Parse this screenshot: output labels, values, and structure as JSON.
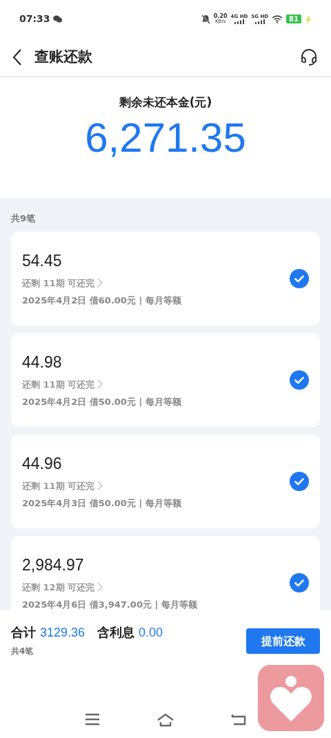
{
  "status_bar": {
    "time": "07:33",
    "speed": "0.20",
    "speed_unit": "KB/s",
    "sim1": "4G HD",
    "sim2": "5G HD",
    "battery": "81"
  },
  "header": {
    "title": "查账还款"
  },
  "summary": {
    "label": "剩余未还本金(元)",
    "amount": "6,271.35"
  },
  "list": {
    "count": "共9笔",
    "loans": [
      {
        "amount": "54.45",
        "remaining": "还剩 11期 可还完",
        "detail": "2025年4月2日 借60.00元 | 每月等额",
        "selected": true
      },
      {
        "amount": "44.98",
        "remaining": "还剩 11期 可还完",
        "detail": "2025年4月2日 借50.00元 | 每月等额",
        "selected": true
      },
      {
        "amount": "44.96",
        "remaining": "还剩 11期 可还完",
        "detail": "2025年4月3日 借50.00元 | 每月等额",
        "selected": true
      },
      {
        "amount": "2,984.97",
        "remaining": "还剩 12期 可还完",
        "detail": "2025年4月6日 借3,947.00元 | 每月等额",
        "selected": true
      }
    ]
  },
  "footer": {
    "total_label": "合计",
    "total": "3129.36",
    "interest_label": "含利息",
    "interest": "0.00",
    "count": "共4笔",
    "button": "提前还款"
  }
}
